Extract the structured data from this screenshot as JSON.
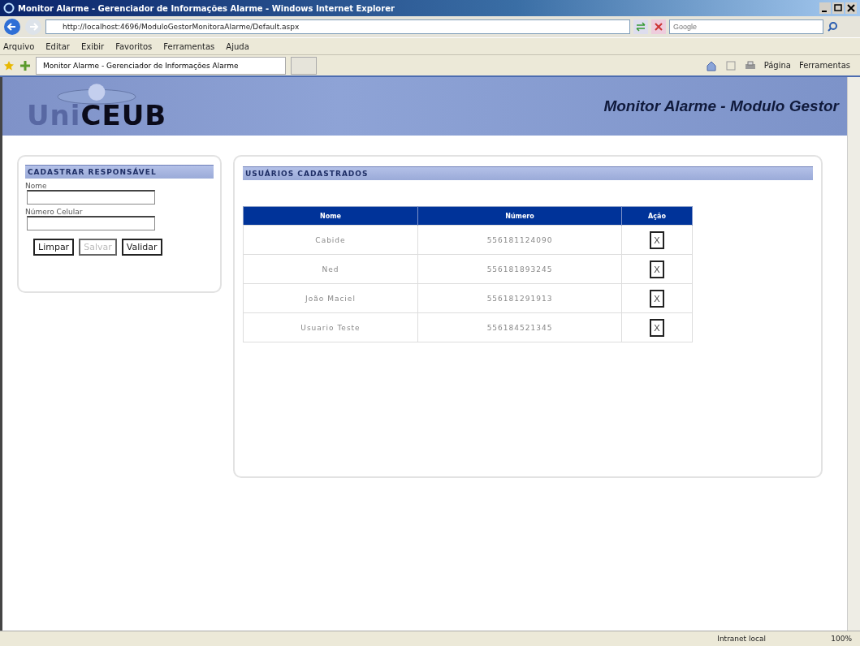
{
  "window": {
    "title": "Monitor Alarme - Gerenciador de Informações Alarme - Windows Internet Explorer"
  },
  "address_bar": {
    "url": "http://localhost:4696/ModuloGestorMonitoraAlarme/Default.aspx"
  },
  "search": {
    "placeholder": "Google"
  },
  "menu": [
    "Arquivo",
    "Editar",
    "Exibir",
    "Favoritos",
    "Ferramentas",
    "Ajuda"
  ],
  "tab": {
    "label": "Monitor Alarme - Gerenciador de Informações Alarme",
    "selected": true
  },
  "command_bar": [
    "Página",
    "Ferramentas"
  ],
  "header": {
    "logo_prefix": "Uni",
    "logo_main": "CEUB",
    "title": "Monitor Alarme - Modulo Gestor"
  },
  "form": {
    "title": "CADASTRAR RESPONSÁVEL",
    "fields": [
      {
        "label": "Nome"
      },
      {
        "label": "Número Celular"
      }
    ],
    "buttons": [
      {
        "label": "Limpar",
        "disabled": false
      },
      {
        "label": "Salvar",
        "disabled": true
      },
      {
        "label": "Validar",
        "disabled": false
      }
    ]
  },
  "users": {
    "title": "USUÁRIOS CADASTRADOS",
    "columns": [
      "Nome",
      "Número",
      "Ação"
    ],
    "rows": [
      {
        "name": "Cabide",
        "number": "556181124090",
        "action": "X"
      },
      {
        "name": "Ned",
        "number": "556181893245",
        "action": "X"
      },
      {
        "name": "João Maciel",
        "number": "556181291913",
        "action": "X"
      },
      {
        "name": "Usuario Teste",
        "number": "556184521345",
        "action": "X"
      }
    ]
  },
  "status_bar": {
    "zone": "Intranet local",
    "zoom": "100%"
  }
}
